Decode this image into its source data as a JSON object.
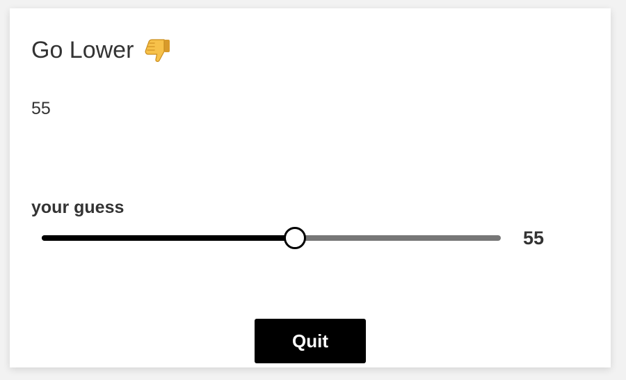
{
  "feedback": {
    "title": "Go Lower",
    "icon": "thumbs-down-icon",
    "current_value": "55"
  },
  "guess_slider": {
    "label": "your guess",
    "value": 55,
    "min": 0,
    "max": 100,
    "value_label": "55"
  },
  "actions": {
    "quit_label": "Quit"
  },
  "colors": {
    "slider_filled": "#000000",
    "slider_empty": "#777777",
    "button_bg": "#000000",
    "button_text": "#ffffff",
    "icon_yellow": "#f7c14a"
  }
}
